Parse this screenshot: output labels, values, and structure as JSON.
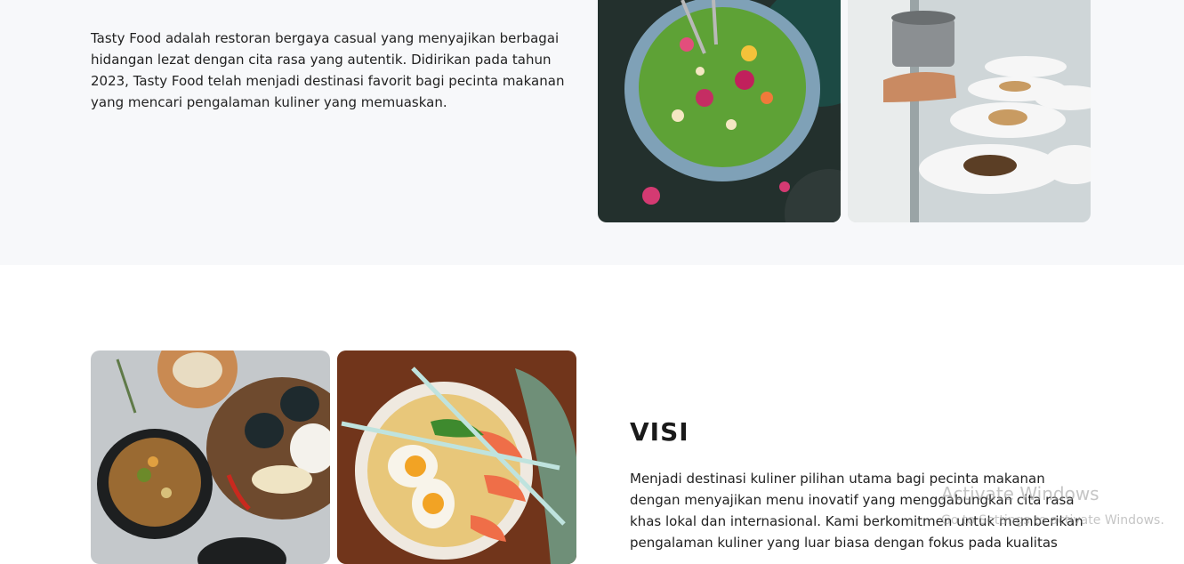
{
  "about": {
    "paragraph": "Tasty Food adalah restoran bergaya casual yang menyajikan berbagai hidangan lezat dengan cita rasa yang autentik. Didirikan pada tahun 2023, Tasty Food telah menjadi destinasi favorit bagi pecinta makanan yang mencari pengalaman kuliner yang memuaskan."
  },
  "vision": {
    "title": "VISI",
    "paragraph": "Menjadi destinasi kuliner pilihan utama bagi pecinta makanan dengan menyajikan menu inovatif yang menggabungkan cita rasa khas lokal dan internasional. Kami berkomitmen untuk memberikan pengalaman kuliner yang luar biasa dengan fokus pada kualitas"
  },
  "watermark": {
    "title": "Activate Windows",
    "subtitle": "Go to Settings to activate Windows."
  },
  "colors": {
    "about_bg": "#f7f8fa",
    "page_bg": "#ffffff",
    "text": "#222222"
  }
}
